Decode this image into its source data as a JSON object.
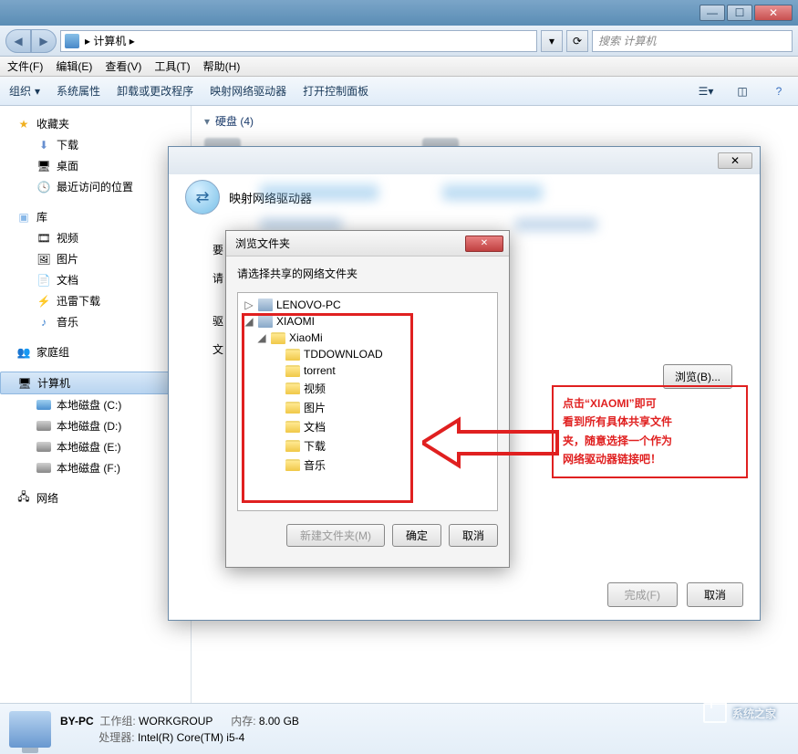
{
  "titlebar": {
    "min": "—",
    "max": "☐",
    "close": "✕"
  },
  "addr": {
    "path": "计算机",
    "crumb_arrow": "▸",
    "search_ph": "搜索 计算机",
    "refresh": "⟳",
    "dd": "▾"
  },
  "menu": [
    "文件(F)",
    "编辑(E)",
    "查看(V)",
    "工具(T)",
    "帮助(H)"
  ],
  "toolbar": {
    "org": "组织",
    "arrow": "▾",
    "items": [
      "系统属性",
      "卸载或更改程序",
      "映射网络驱动器",
      "打开控制面板"
    ]
  },
  "nav": {
    "fav": {
      "label": "收藏夹",
      "items": [
        "下载",
        "桌面",
        "最近访问的位置"
      ]
    },
    "lib": {
      "label": "库",
      "items": [
        "视频",
        "图片",
        "文档",
        "迅雷下载",
        "音乐"
      ]
    },
    "home": "家庭组",
    "comp": {
      "label": "计算机",
      "items": [
        "本地磁盘 (C:)",
        "本地磁盘 (D:)",
        "本地磁盘 (E:)",
        "本地磁盘 (F:)"
      ]
    },
    "net": "网络"
  },
  "content": {
    "hd_head": "硬盘 (4)",
    "drives": [
      "本地磁盘 (C:)",
      "本地磁盘 (D:)"
    ]
  },
  "mapdlg": {
    "title": "映射网络驱动器",
    "row_x": "要",
    "row_q": "请",
    "row_q2": "驱",
    "row_w": "文",
    "browse": "浏览(B)...",
    "finish": "完成(F)",
    "cancel": "取消"
  },
  "browse": {
    "title": "浏览文件夹",
    "msg": "请选择共享的网络文件夹",
    "tree": {
      "n1": "LENOVO-PC",
      "n2": "XIAOMI",
      "n3": "XiaoMi",
      "leaves": [
        "TDDOWNLOAD",
        "torrent",
        "视频",
        "图片",
        "文档",
        "下载",
        "音乐"
      ]
    },
    "newfolder": "新建文件夹(M)",
    "ok": "确定",
    "cancel": "取消"
  },
  "annot": {
    "l1": "点击“XIAOMI”即可",
    "l2": "看到所有具体共享文件",
    "l3": "夹，随意选择一个作为",
    "l4": "网络驱动器链接吧！"
  },
  "status": {
    "pc": "BY-PC",
    "wg_lbl": "工作组:",
    "wg": "WORKGROUP",
    "mem_lbl": "内存:",
    "mem": "8.00 GB",
    "cpu_lbl": "处理器:",
    "cpu": "Intel(R) Core(TM) i5-4"
  },
  "watermark": "系统之家"
}
